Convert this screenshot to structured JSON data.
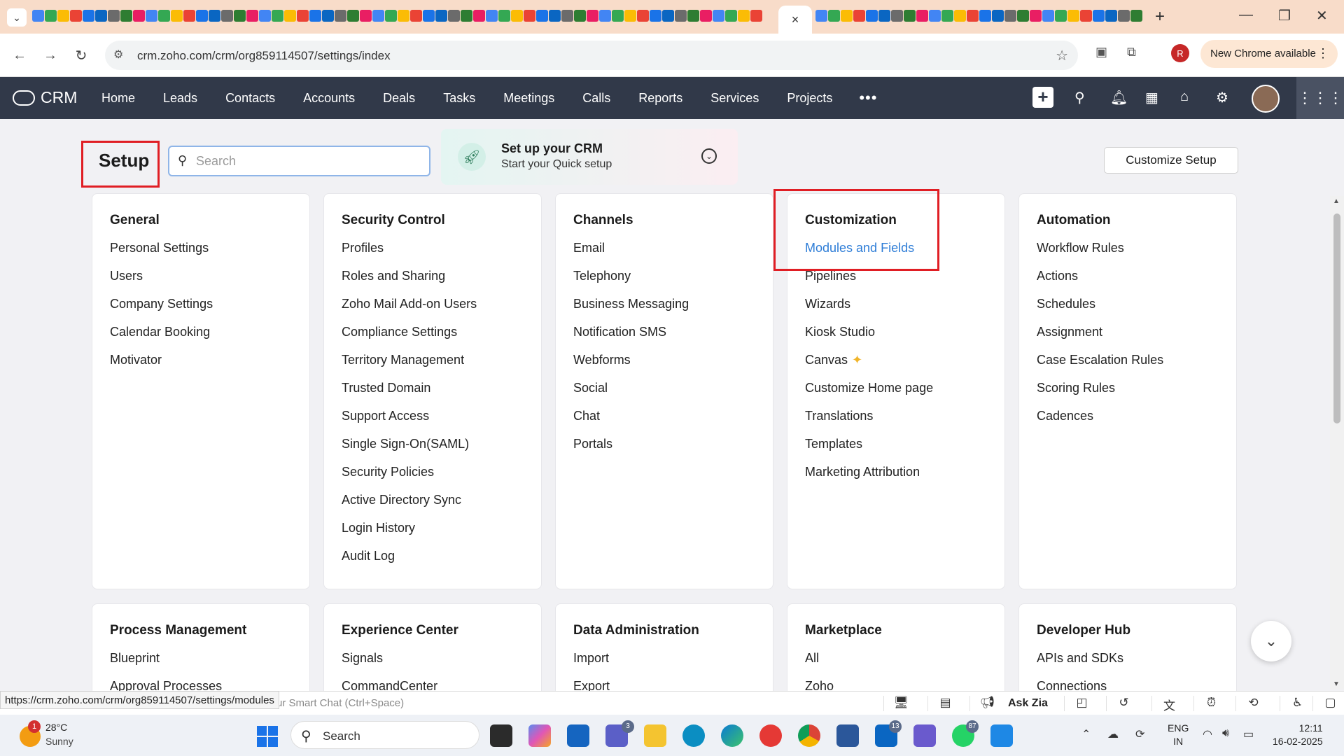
{
  "browser": {
    "address": "crm.zoho.com/crm/org859114507/settings/index",
    "close_tab": "×",
    "new_tab": "+",
    "new_chrome_label": "New Chrome available",
    "profile_initial": "R",
    "status_url": "https://crm.zoho.com/crm/org859114507/settings/modules"
  },
  "crm": {
    "logo_text": "CRM",
    "nav": [
      "Home",
      "Leads",
      "Contacts",
      "Accounts",
      "Deals",
      "Tasks",
      "Meetings",
      "Calls",
      "Reports",
      "Services",
      "Projects"
    ],
    "nav_more": "•••"
  },
  "setup": {
    "title": "Setup",
    "search_placeholder": "Search",
    "quick_setup_title": "Set up your CRM",
    "quick_setup_subtitle": "Start your Quick setup",
    "customize_button": "Customize Setup"
  },
  "cards": [
    {
      "title": "General",
      "items": [
        "Personal Settings",
        "Users",
        "Company Settings",
        "Calendar Booking",
        "Motivator"
      ]
    },
    {
      "title": "Security Control",
      "items": [
        "Profiles",
        "Roles and Sharing",
        "Zoho Mail Add-on Users",
        "Compliance Settings",
        "Territory Management",
        "Trusted Domain",
        "Support Access",
        "Single Sign-On(SAML)",
        "Security Policies",
        "Active Directory Sync",
        "Login History",
        "Audit Log"
      ]
    },
    {
      "title": "Channels",
      "items": [
        "Email",
        "Telephony",
        "Business Messaging",
        "Notification SMS",
        "Webforms",
        "Social",
        "Chat",
        "Portals"
      ]
    },
    {
      "title": "Customization",
      "items": [
        "Modules and Fields",
        "Pipelines",
        "Wizards",
        "Kiosk Studio",
        "Canvas",
        "Customize Home page",
        "Translations",
        "Templates",
        "Marketing Attribution"
      ]
    },
    {
      "title": "Automation",
      "items": [
        "Workflow Rules",
        "Actions",
        "Schedules",
        "Assignment",
        "Case Escalation Rules",
        "Scoring Rules",
        "Cadences"
      ]
    },
    {
      "title": "Process Management",
      "items": [
        "Blueprint",
        "Approval Processes"
      ]
    },
    {
      "title": "Experience Center",
      "items": [
        "Signals",
        "CommandCenter"
      ]
    },
    {
      "title": "Data Administration",
      "items": [
        "Import",
        "Export"
      ]
    },
    {
      "title": "Marketplace",
      "items": [
        "All",
        "Zoho"
      ]
    },
    {
      "title": "Developer Hub",
      "items": [
        "APIs and SDKs",
        "Connections"
      ]
    }
  ],
  "zia_bar": {
    "hint": "ur Smart Chat (Ctrl+Space)",
    "ask_zia": "Ask Zia"
  },
  "taskbar": {
    "weather_temp": "28°C",
    "weather_desc": "Sunny",
    "weather_badge": "1",
    "search_label": "Search",
    "teams_badge": "3",
    "linkedin_badge": "13",
    "whatsapp_badge": "87",
    "lang_line1": "ENG",
    "lang_line2": "IN",
    "time": "12:11",
    "date": "16-02-2025"
  }
}
